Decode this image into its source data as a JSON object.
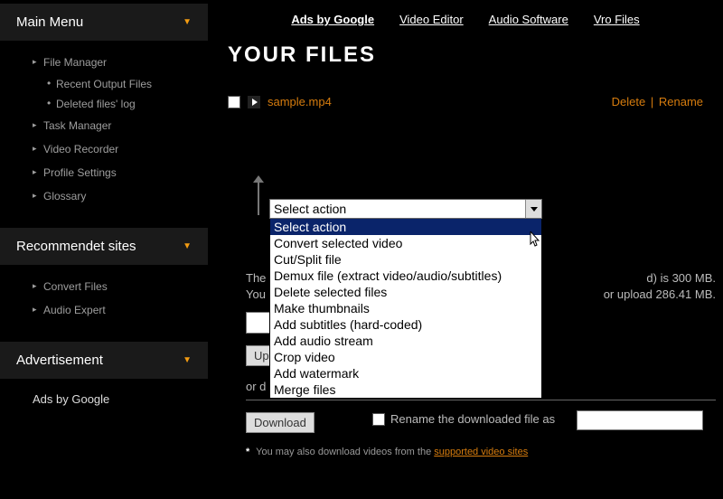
{
  "top_links": {
    "ads": "Ads by Google",
    "video_editor": "Video Editor",
    "audio_software": "Audio Software",
    "vro_files": "Vro Files"
  },
  "page_title": "YOUR FILES",
  "sidebar": {
    "main_menu": {
      "title": "Main Menu",
      "items": [
        {
          "label": "File Manager",
          "subs": [
            "Recent Output Files",
            "Deleted files' log"
          ]
        },
        {
          "label": "Task Manager"
        },
        {
          "label": "Video Recorder"
        },
        {
          "label": "Profile Settings"
        },
        {
          "label": "Glossary"
        }
      ]
    },
    "recommended": {
      "title": "Recommendet sites",
      "items": [
        {
          "label": "Convert Files"
        },
        {
          "label": "Audio Expert"
        }
      ]
    },
    "advertisement": {
      "title": "Advertisement",
      "ads_label": "Ads by Google"
    }
  },
  "file": {
    "name": "sample.mp4",
    "delete": "Delete",
    "rename": "Rename"
  },
  "select": {
    "current": "Select action",
    "options": [
      "Select action",
      "Convert selected video",
      "Cut/Split file",
      "Demux file (extract video/audio/subtitles)",
      "Delete selected files",
      "Make thumbnails",
      "Add subtitles (hard-coded)",
      "Add audio stream",
      "Crop video",
      "Add watermark",
      "Merge files"
    ]
  },
  "info": {
    "line1_prefix": "The",
    "line1_suffix": "d) is 300 MB.",
    "line2_prefix": "You",
    "line2_suffix": "or upload 286.41 MB."
  },
  "buttons": {
    "upload": "Up",
    "download": "Download",
    "or_download": "or d"
  },
  "rename_downloaded": "Rename the downloaded file as",
  "footnote": {
    "text": "You may also download videos from the ",
    "link": "supported video sites"
  }
}
